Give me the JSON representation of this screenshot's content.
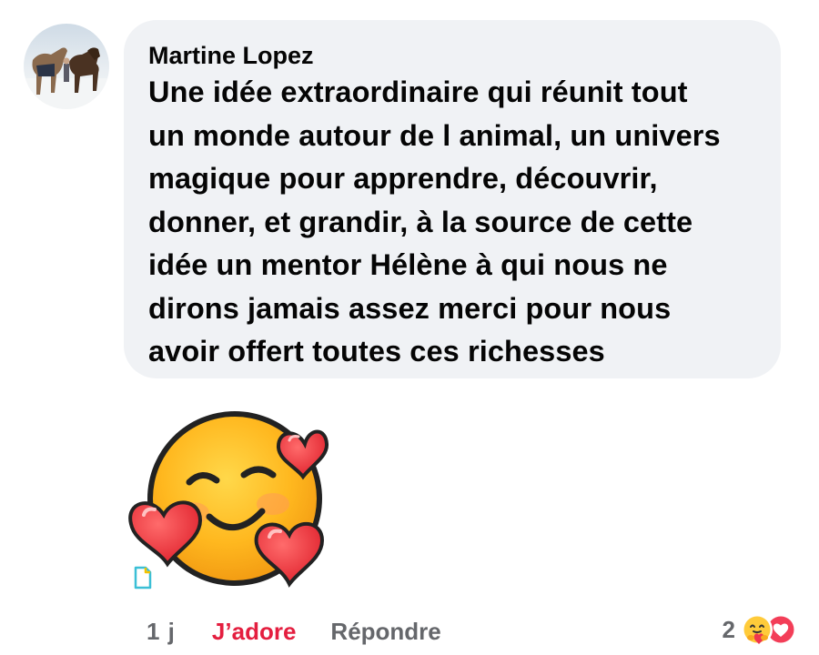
{
  "comment": {
    "author": "Martine Lopez",
    "text": "Une idée extraordinaire qui réunit tout\nun monde autour de l animal, un univers\nmagique pour apprendre, découvrir,\ndonner, et grandir, à la source de cette\nidée un mentor Hélène à qui nous ne\ndirons jamais assez merci pour nous\navoir offert toutes ces richesses",
    "sticker_icon": "smiling-face-with-hearts-icon"
  },
  "actions": {
    "timestamp": "1 j",
    "love_label": "J’adore",
    "reply_label": "Répondre"
  },
  "reactions": {
    "count": "2",
    "icons": [
      "care-icon",
      "love-icon"
    ]
  },
  "colors": {
    "bubble": "#f0f2f5",
    "text": "#050505",
    "secondary": "#65676b",
    "love": "#e41e3f"
  }
}
